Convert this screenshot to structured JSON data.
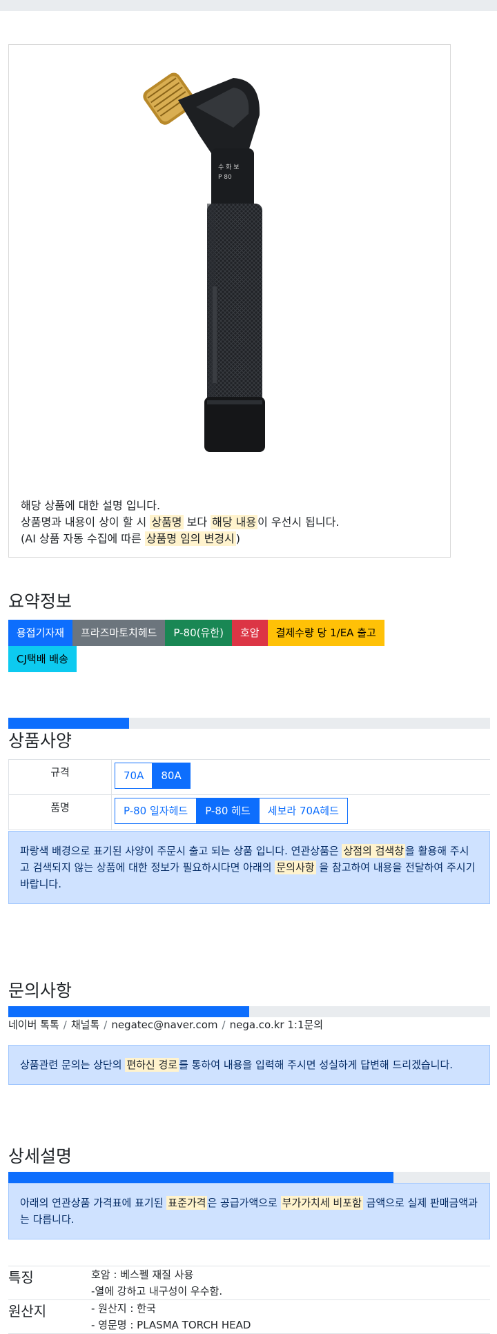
{
  "product_card": {
    "image_alt": "plasma torch head",
    "desc_line1": "해당 상품에 대한 설명 입니다.",
    "desc_line2_a": "상품명과 내용이 상이 할 시 ",
    "desc_line2_hl1": "상품명",
    "desc_line2_b": " 보다 ",
    "desc_line2_hl2": "해당 내용",
    "desc_line2_c": "이 우선시 됩니다.",
    "desc_line3_a": "(AI 상품 자동 수집에 따른 ",
    "desc_line3_hl": "상품명 임의 변경시",
    "desc_line3_b": ")"
  },
  "summary": {
    "title": "요약정보",
    "badges": [
      {
        "label": "용접기자재",
        "color": "#0d6efd"
      },
      {
        "label": "프라즈마토치헤드",
        "color": "#6c757d"
      },
      {
        "label": "P-80(유한)",
        "color": "#198754"
      },
      {
        "label": "호암",
        "color": "#dc3545"
      },
      {
        "label": "결제수량 당 1/EA 출고",
        "color": "#ffc107"
      },
      {
        "label": "CJ택배 배송",
        "color": "#0dcaf0"
      }
    ]
  },
  "spec": {
    "progress": 0.25,
    "title": "상품사양",
    "rows": [
      {
        "label": "규격",
        "options": [
          "70A",
          "80A"
        ],
        "selected": "80A"
      },
      {
        "label": "품명",
        "options": [
          "P-80 일자헤드",
          "P-80 헤드",
          "세보라 70A헤드"
        ],
        "selected": "P-80 헤드"
      }
    ],
    "notice_a": "파랑색 배경으로 표기된 사양이 주문시 출고 되는 상품 입니다. 연관상품은 ",
    "notice_hl1": "상점의 검색창",
    "notice_b": "을 활용해 주시고 검색되지 않는 상품에 대한 정보가 필요하시다면 아래의 ",
    "notice_hl2": "문의사항",
    "notice_c": " 을 참고하여 내용을 전달하여 주시기 바랍니다."
  },
  "inquiry": {
    "title": "문의사항",
    "progress": 0.5,
    "links": [
      "네이버 톡톡",
      "채널톡",
      "negatec@naver.com",
      "nega.co.kr 1:1문의"
    ],
    "separator": "/",
    "notice_a": "상품관련 문의는 상단의 ",
    "notice_hl": "편하신 경로",
    "notice_b": "를 통하여 내용을 입력해 주시면 성실하게 답변해 드리겠습니다."
  },
  "detail": {
    "title": "상세설명",
    "progress": 0.8,
    "notice_a": "아래의 연관상품 가격표에 표기된 ",
    "notice_hl1": "표준가격",
    "notice_b": "은 공급가액으로 ",
    "notice_hl2": "부가가치세 비포함",
    "notice_c": " 금액으로 실제 판매금액과는 다릅니다.",
    "rows": [
      {
        "head": "특징",
        "lines": [
          "호암 : 베스펠 재질 사용",
          "-열에 강하고 내구성이 우수함."
        ]
      },
      {
        "head": "원산지",
        "lines": [
          "- 원산지 : 한국",
          "- 영문명 : PLASMA TORCH HEAD"
        ]
      }
    ]
  }
}
